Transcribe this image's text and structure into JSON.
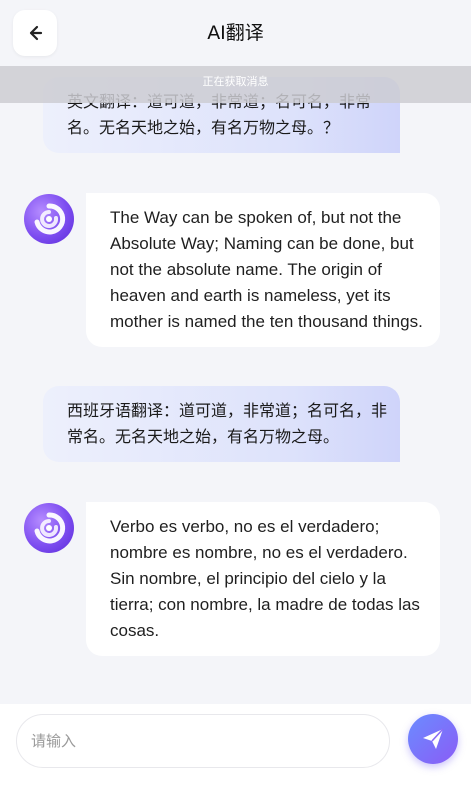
{
  "header": {
    "title": "AI翻译",
    "back_icon": "arrow-left-icon"
  },
  "status": {
    "text": "正在获取消息"
  },
  "messages": [
    {
      "role": "user",
      "text": "英文翻译：道可道，非常道；名可名，非常名。无名天地之始，有名万物之母。？"
    },
    {
      "role": "assistant",
      "avatar_icon": "ai-logo-icon",
      "text": "The Way can be spoken of, but not the Absolute Way; Naming can be done, but not the absolute name. The origin of heaven and earth is nameless, yet its mother is named the ten thousand things."
    },
    {
      "role": "user",
      "text": "西班牙语翻译：道可道，非常道；名可名，非常名。无名天地之始，有名万物之母。"
    },
    {
      "role": "assistant",
      "avatar_icon": "ai-logo-icon",
      "text": "Verbo es verbo, no es el verdadero; nombre es nombre, no es el verdadero. Sin nombre, el principio del cielo y la tierra; con nombre, la madre de todas las cosas."
    }
  ],
  "composer": {
    "placeholder": "请输入",
    "value": "",
    "send_icon": "send-icon"
  },
  "colors": {
    "accent": "#7b5cf5",
    "user_bubble": "#dde2fb",
    "bot_bubble": "#ffffff",
    "background": "#f4f5f9"
  }
}
